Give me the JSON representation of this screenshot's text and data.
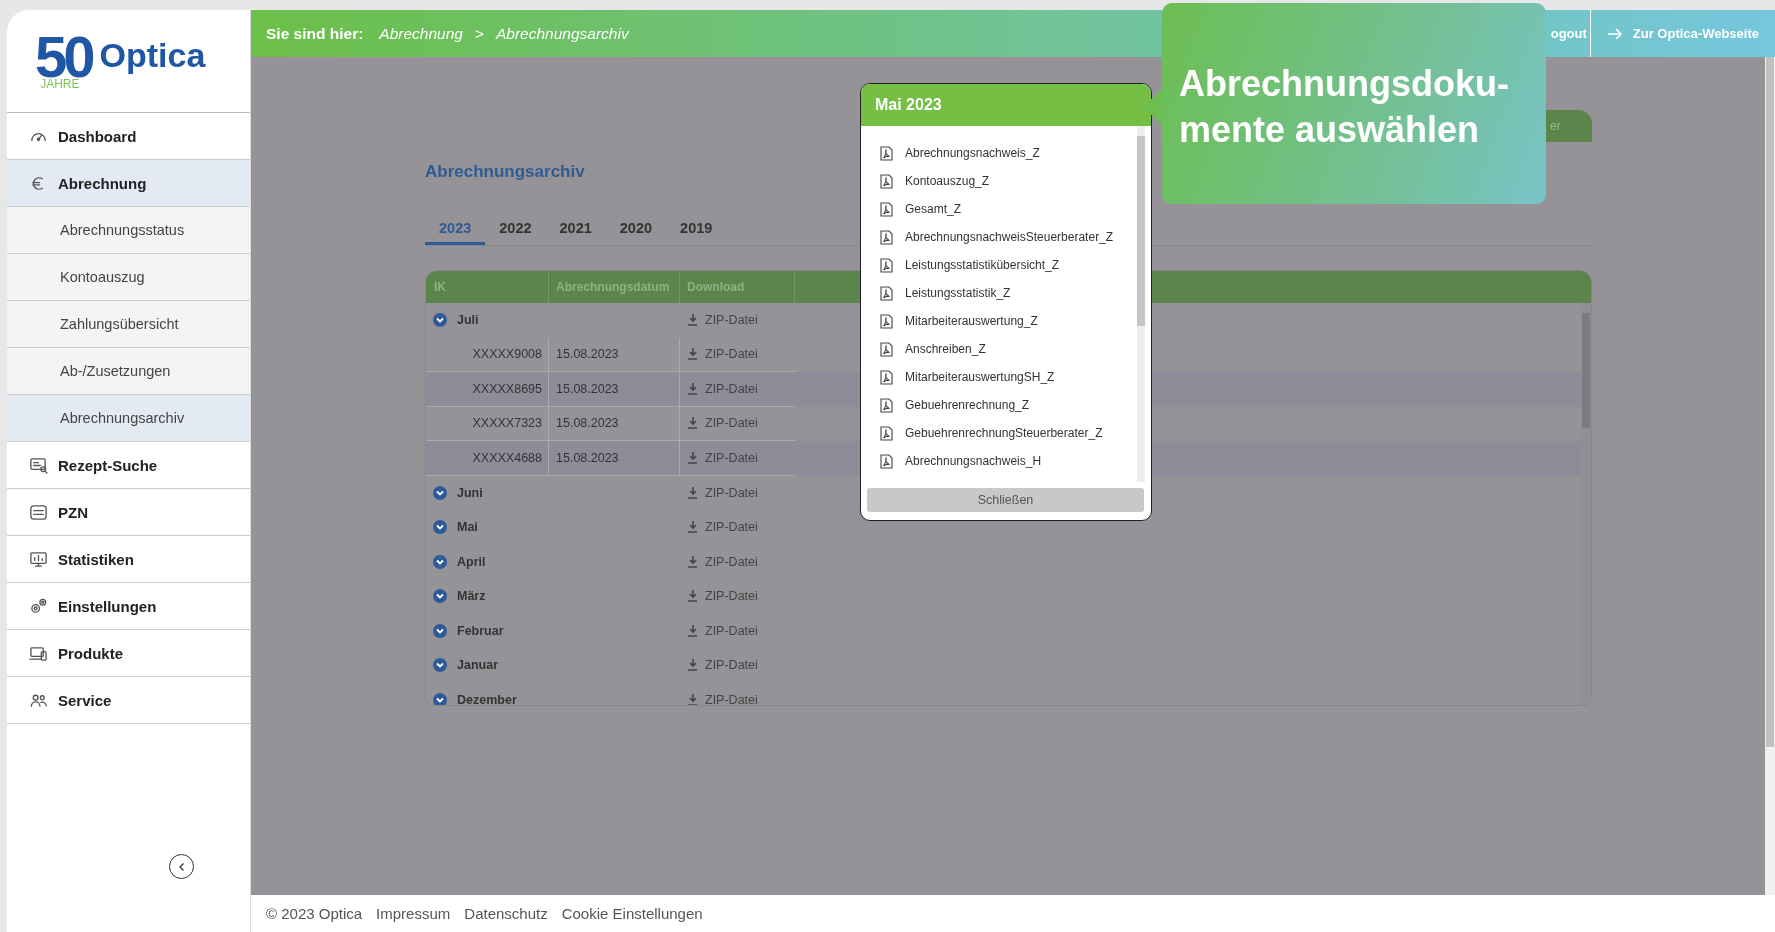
{
  "logo": {
    "number": "50",
    "subtitle": "JAHRE",
    "brand": "Optica"
  },
  "sidebar": {
    "items": [
      {
        "label": "Dashboard",
        "selected": false
      },
      {
        "label": "Abrechnung",
        "selected": true,
        "children": [
          {
            "label": "Abrechnungsstatus",
            "selected": false
          },
          {
            "label": "Kontoauszug",
            "selected": false
          },
          {
            "label": "Zahlungsübersicht",
            "selected": false
          },
          {
            "label": "Ab-/Zusetzungen",
            "selected": false
          },
          {
            "label": "Abrechnungsarchiv",
            "selected": true
          }
        ]
      },
      {
        "label": "Rezept-Suche",
        "selected": false
      },
      {
        "label": "PZN",
        "selected": false
      },
      {
        "label": "Statistiken",
        "selected": false
      },
      {
        "label": "Einstellungen",
        "selected": false
      },
      {
        "label": "Produkte",
        "selected": false
      },
      {
        "label": "Service",
        "selected": false
      }
    ]
  },
  "header": {
    "breadcrumb_label": "Sie sind hier:",
    "breadcrumb": [
      "Abrechnung",
      "Abrechnungsarchiv"
    ],
    "separator": ">",
    "logout": "ogout",
    "website_link": "Zur Optica-Webseite"
  },
  "page": {
    "action_button": "er",
    "title": "Abrechnungsarchiv",
    "tabs": [
      {
        "label": "2023",
        "selected": true
      },
      {
        "label": "2022",
        "selected": false
      },
      {
        "label": "2021",
        "selected": false
      },
      {
        "label": "2020",
        "selected": false
      },
      {
        "label": "2019",
        "selected": false
      }
    ],
    "table": {
      "columns": [
        "IK",
        "Abrechnungsdatum",
        "Download"
      ],
      "rows": [
        {
          "month": "Juli",
          "download": "ZIP-Datei",
          "children": [
            {
              "ik": "XXXXX9008",
              "date": "15.08.2023",
              "download": "ZIP-Datei"
            },
            {
              "ik": "XXXXX8695",
              "date": "15.08.2023",
              "download": "ZIP-Datei"
            },
            {
              "ik": "XXXXX7323",
              "date": "15.08.2023",
              "download": "ZIP-Datei"
            },
            {
              "ik": "XXXXX4688",
              "date": "15.08.2023",
              "download": "ZIP-Datei"
            }
          ]
        },
        {
          "month": "Juni",
          "download": "ZIP-Datei"
        },
        {
          "month": "Mai",
          "download": "ZIP-Datei"
        },
        {
          "month": "April",
          "download": "ZIP-Datei"
        },
        {
          "month": "März",
          "download": "ZIP-Datei"
        },
        {
          "month": "Februar",
          "download": "ZIP-Datei"
        },
        {
          "month": "Januar",
          "download": "ZIP-Datei"
        },
        {
          "month": "Dezember",
          "download": "ZIP-Datei"
        }
      ]
    }
  },
  "dialog": {
    "title": "Mai 2023",
    "documents": [
      "Abrechnungsnachweis_Z",
      "Kontoauszug_Z",
      "Gesamt_Z",
      "AbrechnungsnachweisSteuerberater_Z",
      "Leistungsstatistikübersicht_Z",
      "Leistungsstatistik_Z",
      "Mitarbeiterauswertung_Z",
      "Anschreiben_Z",
      "MitarbeiterauswertungSH_Z",
      "Gebuehrenrechnung_Z",
      "GebuehrenrechnungSteuerberater_Z",
      "Abrechnungsnachweis_H"
    ],
    "close_button": "Schließen"
  },
  "tooltip": {
    "text": "Abrechnungsdoku-mente auswählen"
  },
  "footer": {
    "copyright": "© 2023 Optica",
    "links": [
      "Impressum",
      "Datenschutz",
      "Cookie Einstellungen"
    ]
  }
}
